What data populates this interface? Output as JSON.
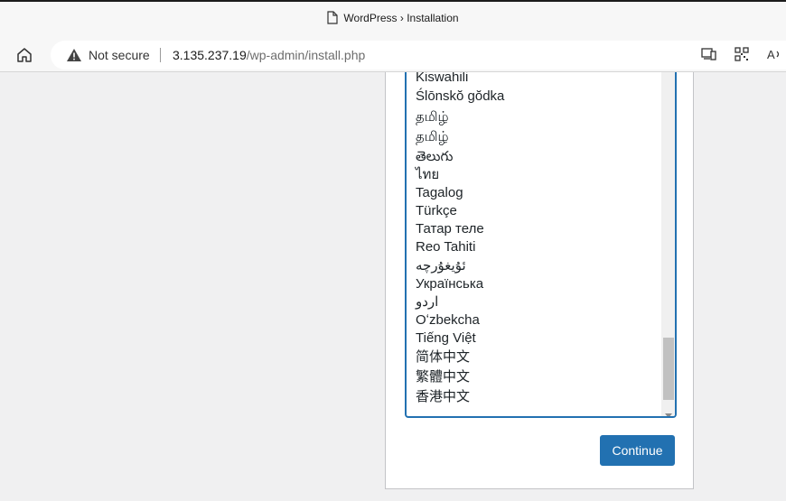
{
  "browser": {
    "tab_title": "WordPress › Installation",
    "security_label": "Not secure",
    "url_host": "3.135.237.19",
    "url_path": "/wp-admin/install.php"
  },
  "language_list": {
    "items": [
      "Kiswahili",
      "Ślōnskŏ gŏdka",
      "தமிழ்",
      "தமிழ்",
      "తెలుగు",
      "ไทย",
      "Tagalog",
      "Türkçe",
      "Татар теле",
      "Reo Tahiti",
      "ئۇيغۇرچە",
      "Українська",
      "اردو",
      "Oʻzbekcha",
      "Tiếng Việt",
      "简体中文",
      "繁體中文",
      "香港中文"
    ]
  },
  "form": {
    "continue_label": "Continue"
  },
  "colors": {
    "accent": "#2271b1",
    "page_background": "#f0f0f1"
  }
}
